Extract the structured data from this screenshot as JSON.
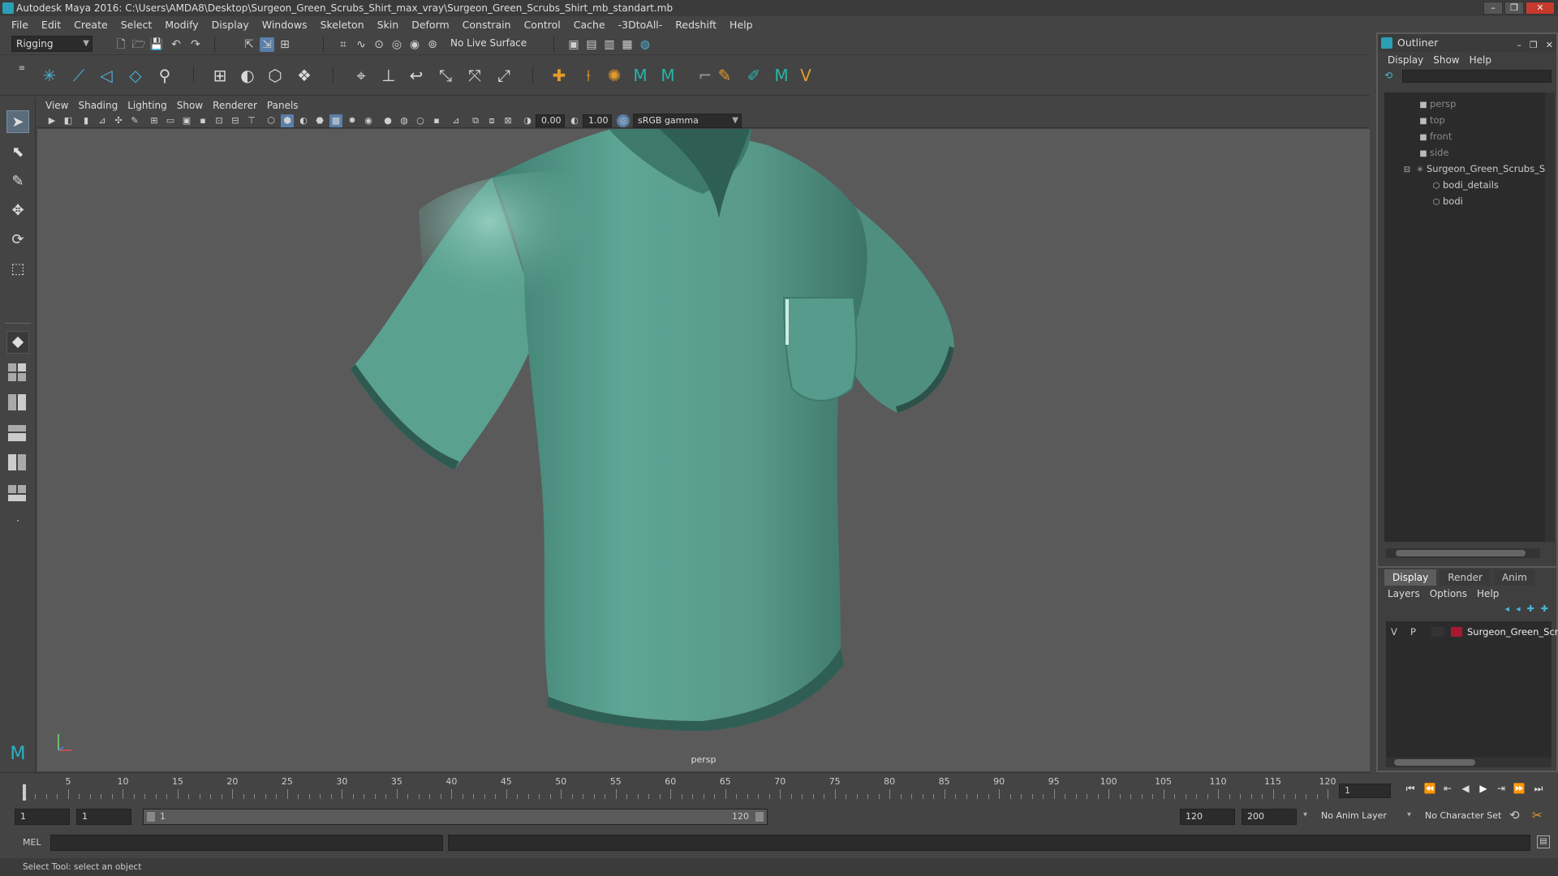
{
  "window": {
    "title": "Autodesk Maya 2016: C:\\Users\\AMDA8\\Desktop\\Surgeon_Green_Scrubs_Shirt_max_vray\\Surgeon_Green_Scrubs_Shirt_mb_standart.mb"
  },
  "menu": [
    "File",
    "Edit",
    "Create",
    "Select",
    "Modify",
    "Display",
    "Windows",
    "Skeleton",
    "Skin",
    "Deform",
    "Constrain",
    "Control",
    "Cache",
    "-3DtoAll-",
    "Redshift",
    "Help"
  ],
  "status": {
    "menuset": "Rigging",
    "live_surface": "No Live Surface"
  },
  "panel": {
    "menu": [
      "View",
      "Shading",
      "Lighting",
      "Show",
      "Renderer",
      "Panels"
    ],
    "near_value": "0.00",
    "far_value": "1.00",
    "color_space": "sRGB gamma",
    "camera": "persp"
  },
  "outliner": {
    "title": "Outliner",
    "menu": [
      "Display",
      "Show",
      "Help"
    ],
    "items": [
      {
        "label": "persp",
        "dim": true
      },
      {
        "label": "top",
        "dim": true
      },
      {
        "label": "front",
        "dim": true
      },
      {
        "label": "side",
        "dim": true
      },
      {
        "label": "Surgeon_Green_Scrubs_Sh",
        "dim": false
      },
      {
        "label": "bodi_details",
        "dim": false
      },
      {
        "label": "bodi",
        "dim": false
      }
    ]
  },
  "layers": {
    "tabs": [
      "Display",
      "Render",
      "Anim"
    ],
    "menu": [
      "Layers",
      "Options",
      "Help"
    ],
    "row": {
      "v": "V",
      "p": "P",
      "name": "Surgeon_Green_Scrub",
      "color": "#a8182e"
    }
  },
  "timeline": {
    "ticks": [
      "5",
      "10",
      "15",
      "20",
      "25",
      "30",
      "35",
      "40",
      "45",
      "50",
      "55",
      "60",
      "65",
      "70",
      "75",
      "80",
      "85",
      "90",
      "95",
      "100",
      "105",
      "110",
      "115",
      "120"
    ],
    "start_tick": "1",
    "current_frame": "1"
  },
  "range": {
    "start": "1",
    "playback_start": "1",
    "slider_start": "1",
    "slider_end": "120",
    "playback_end": "120",
    "end": "200",
    "anim_layer": "No Anim Layer",
    "char_set": "No Character Set"
  },
  "cmd": {
    "label": "MEL"
  },
  "help": {
    "text": "Select Tool: select an object"
  },
  "colors": {
    "shirt": "#5a9a8a",
    "viewport": "#5a5a5a",
    "accent": "#5a7fa8"
  }
}
